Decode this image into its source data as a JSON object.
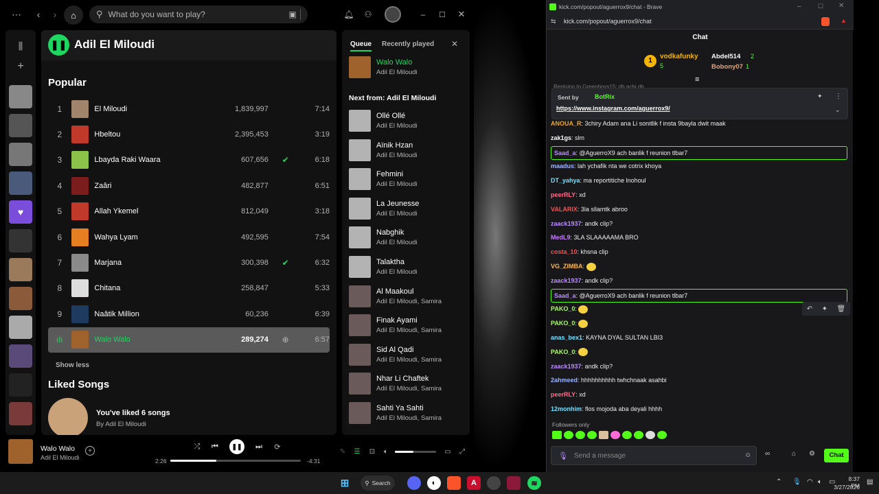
{
  "spotify": {
    "search_placeholder": "What do you want to play?",
    "artist_name": "Adil El Miloudi",
    "popular_title": "Popular",
    "tracks": [
      {
        "num": "1",
        "title": "El Miloudi",
        "plays": "1,839,997",
        "duration": "7:14",
        "liked": false,
        "color": "#a0856a"
      },
      {
        "num": "2",
        "title": "Hbeltou",
        "plays": "2,395,453",
        "duration": "3:19",
        "liked": false,
        "color": "#c0392b"
      },
      {
        "num": "3",
        "title": "Lbayda Raki Waara",
        "plays": "607,656",
        "duration": "6:18",
        "liked": true,
        "color": "#8bc34a"
      },
      {
        "num": "4",
        "title": "Zaâri",
        "plays": "482,877",
        "duration": "6:51",
        "liked": false,
        "color": "#7b1d1d"
      },
      {
        "num": "5",
        "title": "Allah Ykemel",
        "plays": "812,049",
        "duration": "3:18",
        "liked": false,
        "color": "#c0392b"
      },
      {
        "num": "6",
        "title": "Wahya Lyam",
        "plays": "492,595",
        "duration": "7:54",
        "liked": false,
        "color": "#e67e22"
      },
      {
        "num": "7",
        "title": "Marjana",
        "plays": "300,398",
        "duration": "6:32",
        "liked": true,
        "color": "#8a8a8a"
      },
      {
        "num": "8",
        "title": "Chitana",
        "plays": "258,847",
        "duration": "5:33",
        "liked": false,
        "color": "#dddddd"
      },
      {
        "num": "9",
        "title": "Naâtik Million",
        "plays": "60,236",
        "duration": "6:39",
        "liked": false,
        "color": "#1e3a5f"
      },
      {
        "num": "ılı",
        "title": "Walo Walo",
        "plays": "289,274",
        "duration": "6:57",
        "liked": false,
        "color": "#a0622d"
      }
    ],
    "show_less": "Show less",
    "liked_title": "Liked Songs",
    "liked_text": "You've liked 6 songs",
    "liked_by": "By Adil El Miloudi",
    "queue_tab": "Queue",
    "recent_tab": "Recently played",
    "now_playing_title": "Walo Walo",
    "now_playing_artist": "Adil El Miloudi",
    "next_from": "Next from: Adil El Miloudi",
    "queue": [
      {
        "title": "Ollé Ollé",
        "artist": "Adil El Miloudi"
      },
      {
        "title": "Aïnik Hzan",
        "artist": "Adil El Miloudi"
      },
      {
        "title": "Fehmini",
        "artist": "Adil El Miloudi"
      },
      {
        "title": "La Jeunesse",
        "artist": "Adil El Miloudi"
      },
      {
        "title": "Nabghik",
        "artist": "Adil El Miloudi"
      },
      {
        "title": "Talaktha",
        "artist": "Adil El Miloudi"
      },
      {
        "title": "Al Maakoul",
        "artist": "Adil El Miloudi, Samira"
      },
      {
        "title": "Finak Ayami",
        "artist": "Adil El Miloudi, Samira"
      },
      {
        "title": "Sid Al Qadi",
        "artist": "Adil El Miloudi, Samira"
      },
      {
        "title": "Nhar Li Chaftek",
        "artist": "Adil El Miloudi, Samira"
      },
      {
        "title": "Sahti Ya Sahti",
        "artist": "Adil El Miloudi, Samira"
      }
    ],
    "player": {
      "title": "Walo Walo",
      "artist": "Adil El Miloudi",
      "elapsed": "2:26",
      "remaining": "-4:31",
      "progress": 0.35,
      "volume": 0.45
    }
  },
  "browser": {
    "window_title": "kick.com/popout/aguerrox9/chat - Brave",
    "url": "kick.com/popout/aguerrox9/chat",
    "chat_title": "Chat",
    "gifters": [
      {
        "rank": "1",
        "name": "vodkafunky",
        "count": "5"
      },
      {
        "name": "Abdel514",
        "count": "2"
      },
      {
        "name": "Bobony07",
        "count": "1"
      }
    ],
    "replying": "Replying to Greenboys15: db achi db",
    "pinned_by_label": "Sent by",
    "pinned_by": "BotRix",
    "pinned_link": "https://www.instagram.com/aguerrox9/",
    "messages": [
      {
        "user": "ANOUA_R",
        "text": "3chiry Adam ana Li sonitlik f insta 9bayla dwit maak",
        "color": "#f5a623",
        "hl": false
      },
      {
        "user": "zak1gs",
        "text": "slm",
        "color": "#ffffff",
        "hl": false
      },
      {
        "user": "Saad_a",
        "text": "@AguerroX9 ach banlik f reunion tlbar7",
        "color": "#b98cff",
        "hl": true
      },
      {
        "user": "maadus",
        "text": "lah ychafik nta we cotrix khoya",
        "color": "#9fb4ff",
        "hl": false
      },
      {
        "user": "DT_yahya",
        "text": "ma reportitiche lnohoul",
        "color": "#6fe0ff",
        "hl": false
      },
      {
        "user": "peerRLY",
        "text": "xd",
        "color": "#ff6b8a",
        "hl": false
      },
      {
        "user": "VALARIX",
        "text": "3la sllamtk abroo",
        "color": "#ff4d4d",
        "hl": false
      },
      {
        "user": "zaack1937",
        "text": "andk clip?",
        "color": "#b98cff",
        "hl": false
      },
      {
        "user": "MedL9",
        "text": "3LA SLAAAAAMA BRO",
        "color": "#c77dff",
        "hl": false
      },
      {
        "user": "costa_10",
        "text": "khsna clip",
        "color": "#ff4d4d",
        "hl": false
      },
      {
        "user": "VG_ZIMBA",
        "text": "",
        "color": "#ffb84d",
        "hl": false
      },
      {
        "user": "zaack1937",
        "text": "andk clip?",
        "color": "#b98cff",
        "hl": false
      },
      {
        "user": "Saad_a",
        "text": "@AguerroX9 ach banlik f reunion tlbar7",
        "color": "#b98cff",
        "hl": true
      },
      {
        "user": "PAKO_0",
        "text": "",
        "color": "#a6ff4d",
        "hl": false
      },
      {
        "user": "PAKO_0",
        "text": "",
        "color": "#a6ff4d",
        "hl": false
      },
      {
        "user": "anas_bex1",
        "text": "KAYNA DYAL SULTAN LBI3",
        "color": "#6fe0ff",
        "hl": false
      },
      {
        "user": "PAKO_0",
        "text": "",
        "color": "#a6ff4d",
        "hl": false
      },
      {
        "user": "zaack1937",
        "text": "andk clip?",
        "color": "#b98cff",
        "hl": false
      },
      {
        "user": "2ahmeed",
        "text": "hhhhhhhhhh twhchnaak asahbi",
        "color": "#9fb4ff",
        "hl": false
      },
      {
        "user": "peerRLY",
        "text": "xd",
        "color": "#ff6b8a",
        "hl": false
      },
      {
        "user": "12monhim",
        "text": "flos mojoda aba deyali hhhh",
        "color": "#6fe0ff",
        "hl": false
      }
    ],
    "followers_only": "Followers only",
    "send_placeholder": "Send a message",
    "chat_button": "Chat"
  },
  "taskbar": {
    "search": "Search",
    "time": "8:37 PM",
    "date": "3/27/2026"
  },
  "colors": {
    "spotify_green": "#1ed760",
    "kick_green": "#53fc18"
  }
}
